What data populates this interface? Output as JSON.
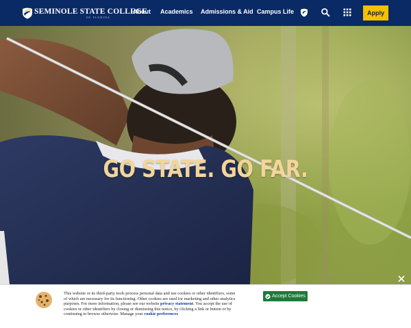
{
  "header": {
    "logo_name": "SEMINOLE STATE COLLEGE",
    "logo_sub": "OF FLORIDA",
    "nav": {
      "about": "About",
      "academics": "Academics",
      "admissions": "Admissions & Aid",
      "campus": "Campus Life"
    },
    "apply_label": "Apply",
    "icons": [
      "shield-icon",
      "search-icon",
      "grid-icon"
    ]
  },
  "hero": {
    "title": "GO STATE. GO FAR."
  },
  "cookie": {
    "text_part1": "This website or its third-party tools process personal data and use cookies or other identifiers, some of which are necessary for its functioning. Other cookies are used for marketing and other analytics purposes. For more information, please see our website ",
    "privacy_link": "privacy statement",
    "text_part2": ". You accept the use of cookies or other identifiers by closing or dismissing this notice, by clicking a link or button or by continuing to browse otherwise. Manage your ",
    "prefs_link": "cookie preferences",
    "accept_label": "Accept Cookies"
  },
  "colors": {
    "header_bg": "#0a2a66",
    "apply_bg": "#f5c000",
    "accept_bg": "#1f7a3a",
    "hero_title": "#f2d59a"
  }
}
